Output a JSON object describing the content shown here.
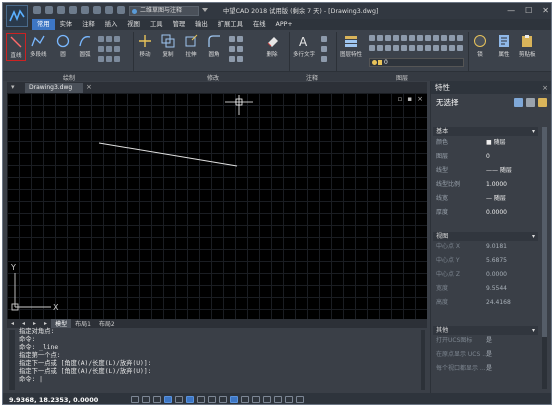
{
  "app": {
    "title": "中望CAD 2018 试用版 (剩余 7 天) - [Drawing3.dwg]",
    "workspace": "二维草图与注释",
    "window_buttons": [
      "—",
      "☐",
      "✕"
    ]
  },
  "menu": {
    "items": [
      {
        "label": "常用",
        "active": true
      },
      {
        "label": "实体",
        "active": false
      },
      {
        "label": "注释",
        "active": false
      },
      {
        "label": "插入",
        "active": false
      },
      {
        "label": "视图",
        "active": false
      },
      {
        "label": "工具",
        "active": false
      },
      {
        "label": "管理",
        "active": false
      },
      {
        "label": "输出",
        "active": false
      },
      {
        "label": "扩展工具",
        "active": false
      },
      {
        "label": "在线",
        "active": false
      },
      {
        "label": "APP+",
        "active": false
      }
    ]
  },
  "ribbon": {
    "tools": {
      "line": "直线",
      "polyline": "多段线",
      "arc": "圆",
      "circle": "圆弧",
      "move": "移动",
      "copy": "复制",
      "stretch": "拉伸",
      "fillet": "圆角",
      "erase": "删除",
      "mtext": "多行文字",
      "layer_props": "图层特性",
      "match": "匹配",
      "properties": "属性",
      "clipboard": "剪贴板",
      "lock": "锁"
    },
    "panels": {
      "draw": "绘制",
      "modify": "修改",
      "annotate": "注释",
      "layers": "图层"
    },
    "layer_current": "0"
  },
  "drawing": {
    "tab_label": "Drawing3.dwg",
    "tab_close": "×",
    "viewport_controls": [
      "▫",
      "▪",
      "×"
    ],
    "ucs_x": "X",
    "ucs_y": "Y",
    "layout_tabs": [
      "◂",
      "◂",
      "▸",
      "▸",
      "模型",
      "布局1",
      "布局2"
    ]
  },
  "command": {
    "lines": [
      "指定对角点:",
      "命令:",
      "命令: _line",
      "指定第一个点:",
      "指定下一点或 [角度(A)/长度(L)/放弃(U)]:",
      "指定下一点或 [角度(A)/长度(L)/放弃(U)]:",
      "命令: |"
    ]
  },
  "status": {
    "coords": "9.9368, 18.2353, 0.0000"
  },
  "properties": {
    "title": "特性",
    "close": "×",
    "selection": "无选择",
    "sections": {
      "general": "基本",
      "geometry": "视图",
      "misc": "其他"
    },
    "general_rows": [
      {
        "key": "颜色",
        "value": "■ 随层"
      },
      {
        "key": "图层",
        "value": "0"
      },
      {
        "key": "线型",
        "value": "—— 随层"
      },
      {
        "key": "线型比例",
        "value": "1.0000"
      },
      {
        "key": "线宽",
        "value": "— 随层"
      },
      {
        "key": "厚度",
        "value": "0.0000"
      }
    ],
    "view_rows": [
      {
        "key": "中心点 X",
        "value": "9.0181"
      },
      {
        "key": "中心点 Y",
        "value": "5.6875"
      },
      {
        "key": "中心点 Z",
        "value": "0.0000"
      },
      {
        "key": "宽度",
        "value": "9.5544"
      },
      {
        "key": "高度",
        "value": "24.4168"
      }
    ],
    "misc_rows": [
      {
        "key": "打开UCS图标",
        "value": "是"
      },
      {
        "key": "在原点显示 UCS ...",
        "value": "是"
      },
      {
        "key": "每个视口都显示 ...",
        "value": "是"
      }
    ]
  },
  "colors": {
    "accent": "#3d76c4",
    "canvas": "#000000",
    "line_selected": "#cc2222"
  }
}
